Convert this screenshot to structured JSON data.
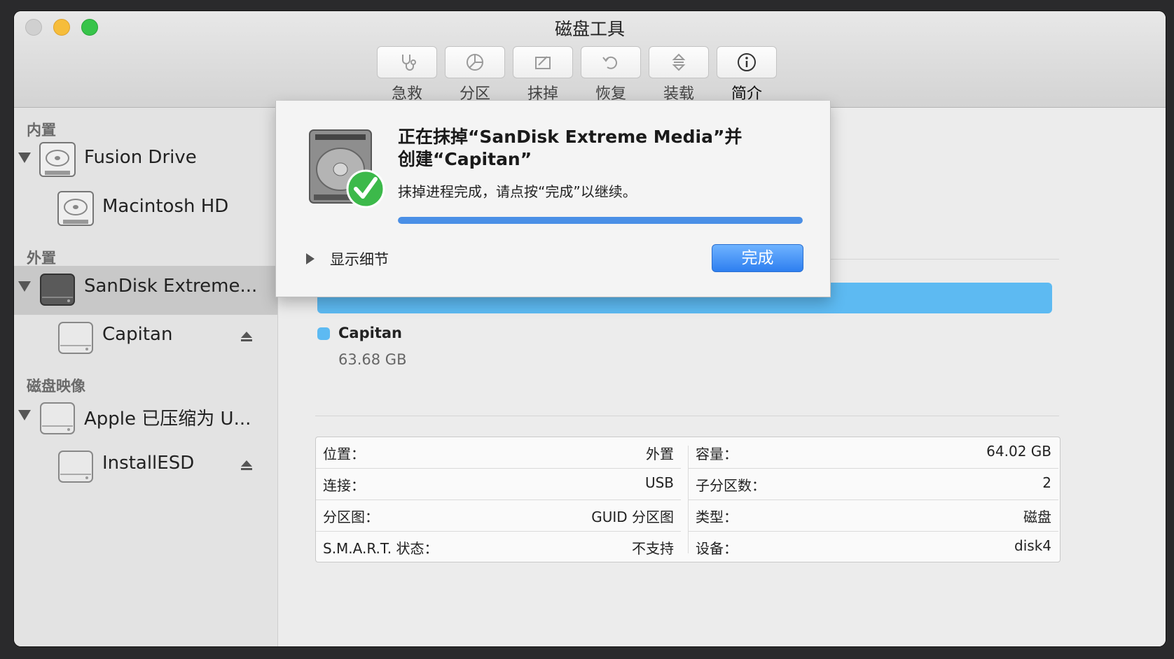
{
  "window": {
    "title": "磁盘工具"
  },
  "toolbar": {
    "items": [
      {
        "label": "急救",
        "icon": "stethoscope-icon"
      },
      {
        "label": "分区",
        "icon": "pie-chart-icon"
      },
      {
        "label": "抹掉",
        "icon": "eraser-icon"
      },
      {
        "label": "恢复",
        "icon": "restore-icon"
      },
      {
        "label": "装载",
        "icon": "mount-icon"
      },
      {
        "label": "简介",
        "icon": "info-icon"
      }
    ]
  },
  "sidebar": {
    "sections": [
      "内置",
      "外置",
      "磁盘映像"
    ],
    "items": [
      {
        "label": "Fusion Drive"
      },
      {
        "label": "Macintosh HD"
      },
      {
        "label": "SanDisk Extreme..."
      },
      {
        "label": "Capitan"
      },
      {
        "label": "Apple 已压缩为 U..."
      },
      {
        "label": "InstallESD"
      }
    ]
  },
  "partition": {
    "name": "Capitan",
    "size": "63.68 GB",
    "color": "#5dbaf2"
  },
  "info": {
    "left": [
      {
        "key": "位置：",
        "value": "外置"
      },
      {
        "key": "连接：",
        "value": "USB"
      },
      {
        "key": "分区图：",
        "value": "GUID 分区图"
      },
      {
        "key": "S.M.A.R.T. 状态：",
        "value": "不支持"
      }
    ],
    "right": [
      {
        "key": "容量：",
        "value": "64.02 GB"
      },
      {
        "key": "子分区数：",
        "value": "2"
      },
      {
        "key": "类型：",
        "value": "磁盘"
      },
      {
        "key": "设备：",
        "value": "disk4"
      }
    ]
  },
  "sheet": {
    "title": "正在抹掉“SanDisk Extreme Media”并创建“Capitan”",
    "message": "抹掉进程完成，请点按“完成”以继续。",
    "progress": 1.0,
    "details_label": "显示细节",
    "done_label": "完成",
    "accent": "#4a8fe6"
  }
}
